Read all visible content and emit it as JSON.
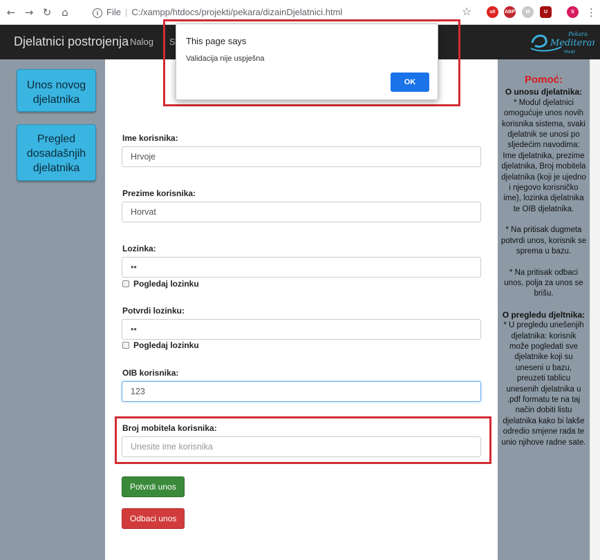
{
  "browser": {
    "url_label": "File",
    "url": "C:/xampp/htdocs/projekti/pekara/dizainDjelatnici.html"
  },
  "navbar": {
    "brand": "Djelatnici postrojenja",
    "links": [
      "Nalog",
      "S"
    ],
    "logo_text": [
      "Pekara",
      "Mediteran",
      "Hvar"
    ]
  },
  "sidebar_left": {
    "buttons": [
      "Unos novog djelatnika",
      "Pregled dosadašnjih djelatnika"
    ]
  },
  "form": {
    "first_name_label": "Ime korisnika:",
    "first_name_value": "Hrvoje",
    "last_name_label": "Prezime korisnika:",
    "last_name_value": "Horvat",
    "password_label": "Lozinka:",
    "password_value": "••",
    "show_password_label": "Pogledaj lozinku",
    "confirm_password_label": "Potvrdi lozinku:",
    "confirm_password_value": "••",
    "show_password_label_2": "Pogledaj lozinku",
    "oib_label": "OIB korisnika:",
    "oib_value": "123",
    "mobile_label": "Broj mobitela korisnika:",
    "mobile_placeholder": "Unesite ime korisnika",
    "confirm_button": "Potvrdi unos",
    "cancel_button": "Odbaci unos"
  },
  "help": {
    "title": "Pomoć:",
    "section1_title": "O unosu djelatnika:",
    "section1_text": "* Modul djelatnici omogućuje unos novih korisnika sistema, svaki djelatnik se unosi po sljedećim navodima: Ime djelatnika, prezime djelatnika, Broj mobitela djelatnika (koji je ujedno i njegovo korisničko ime), lozinka djelatnika te OIB djelatnika.",
    "section1_note1": "* Na pritisak dugmeta potvrdi unos, korisnik se sprema u bazu.",
    "section1_note2": "* Na pritisak odbaci unos, polja za unos se brišu.",
    "section2_title": "O pregledu djeltnika:",
    "section2_text": "* U pregledu unešenjih djelatnika: korisnik može pogledati sve djelatnike koji su uneseni u bazu, preuzeti tablicu unesenih djelatnika u .pdf formatu te na taj način dobiti listu djelatnika kako bi lakše odredio smjene rada te unio njihove radne sate."
  },
  "alert": {
    "title": "This page says",
    "message": "Validacija nije uspješna",
    "ok_button": "OK"
  },
  "colors": {
    "sidebar": "#8d9aa6",
    "side_button": "#3ab4e0",
    "help_title": "#d81b1b",
    "annotation": "#d32b33",
    "confirm": "#3a8a3a",
    "cancel": "#d13b3b"
  }
}
